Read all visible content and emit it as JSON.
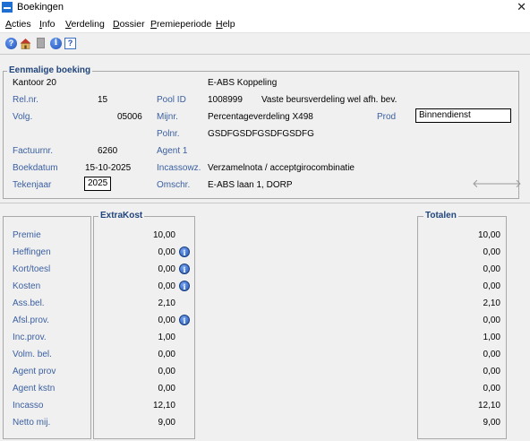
{
  "window": {
    "title": "Boekingen"
  },
  "menu": [
    {
      "first": "A",
      "rest": "cties"
    },
    {
      "first": "I",
      "rest": "nfo"
    },
    {
      "first": "V",
      "rest": "erdeling"
    },
    {
      "first": "D",
      "rest": "ossier"
    },
    {
      "first": "P",
      "rest": "remieperiode"
    },
    {
      "first": "H",
      "rest": "elp"
    }
  ],
  "toolbar": {
    "icons": [
      "help-icon",
      "home-icon",
      "document-icon",
      "info-icon",
      "context-help-icon"
    ],
    "help_glyph": "?",
    "info_glyph": "i",
    "qbox_glyph": "?"
  },
  "booking": {
    "legend": "Eenmalige boeking",
    "office": "Kantoor 20",
    "coupling": "E-ABS Koppeling",
    "relnr_label": "Rel.nr.",
    "relnr": "15",
    "poolid_label": "Pool ID",
    "poolid": "1008999",
    "pool_desc": "Vaste beursverdeling wel afh. bev.",
    "volg_label": "Volg.",
    "volg": "05006",
    "mijnr_label": "Mijnr.",
    "mijnr": "Percentageverdeling  X498",
    "prod_label": "Prod",
    "prod": "Binnendienst",
    "polnr_label": "Polnr.",
    "polnr": "GSDFGSDFGSDFGSDFG",
    "factuurnr_label": "Factuurnr.",
    "factuurnr": "6260",
    "agent_label": "Agent 1",
    "boekdatum_label": "Boekdatum",
    "boekdatum": "15-10-2025",
    "incasso_label": "Incassowz.",
    "incasso": "Verzamelnota / acceptgirocombinatie",
    "tekenjaar_label": "Tekenjaar",
    "tekenjaar": "2025",
    "omschr_label": "Omschr.",
    "omschr": "E-ABS laan 1, DORP",
    "arrow_left": "🡐",
    "arrow_right": "🡒"
  },
  "amounts": {
    "extrakost_legend": "ExtraKost",
    "totalen_legend": "Totalen",
    "info_glyph": "i",
    "rows": [
      {
        "label": "Premie",
        "value": "10,00",
        "total": "10,00",
        "info": false
      },
      {
        "label": "Heffingen",
        "value": "0,00",
        "total": "0,00",
        "info": true
      },
      {
        "label": "Kort/toesl",
        "value": "0,00",
        "total": "0,00",
        "info": true
      },
      {
        "label": "Kosten",
        "value": "0,00",
        "total": "0,00",
        "info": true
      },
      {
        "label": "Ass.bel.",
        "value": "2,10",
        "total": "2,10",
        "info": false
      },
      {
        "label": "Afsl.prov.",
        "value": "0,00",
        "total": "0,00",
        "info": true
      },
      {
        "label": "Inc.prov.",
        "value": "1,00",
        "total": "1,00",
        "info": false
      },
      {
        "label": "Volm. bel.",
        "value": "0,00",
        "total": "0,00",
        "info": false
      },
      {
        "label": "Agent prov",
        "value": "0,00",
        "total": "0,00",
        "info": false
      },
      {
        "label": "Agent kstn",
        "value": "0,00",
        "total": "0,00",
        "info": false
      },
      {
        "label": "Incasso",
        "value": "12,10",
        "total": "12,10",
        "info": false
      },
      {
        "label": "Netto mij.",
        "value": "9,00",
        "total": "9,00",
        "info": false
      }
    ]
  },
  "colors": {
    "label_blue": "#3a5fa0",
    "legend_blue": "#21457d",
    "background": "#f0f0f0"
  }
}
